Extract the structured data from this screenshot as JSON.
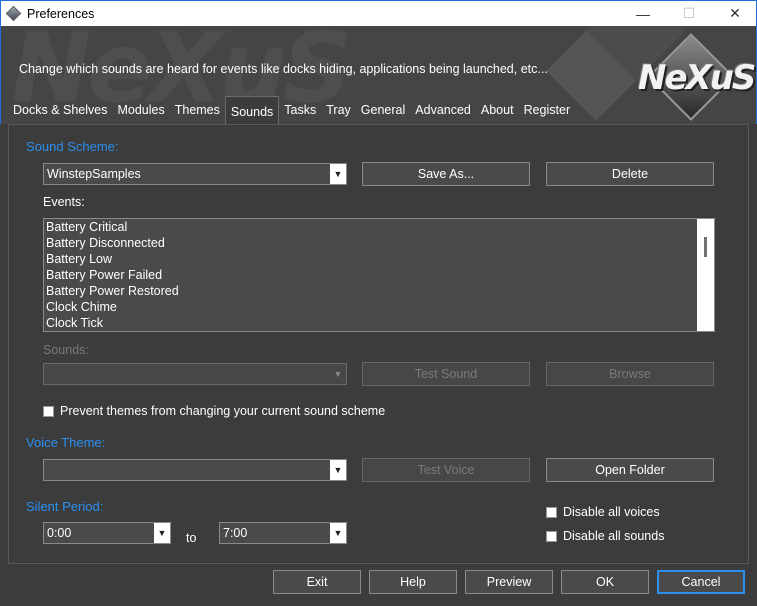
{
  "window": {
    "title": "Preferences",
    "minimize_glyph": "—",
    "maximize_glyph": "☐",
    "close_glyph": "✕"
  },
  "banner": {
    "watermark": "NeXuS",
    "description": "Change which sounds are heard for events like docks hiding, applications being launched, etc...",
    "logo": "NeXuS"
  },
  "tabs": [
    "Docks & Shelves",
    "Modules",
    "Themes",
    "Sounds",
    "Tasks",
    "Tray",
    "General",
    "Advanced",
    "About",
    "Register"
  ],
  "active_tab": "Sounds",
  "sound_scheme": {
    "heading": "Sound Scheme:",
    "selected": "WinstepSamples",
    "save_as": "Save As...",
    "delete": "Delete"
  },
  "events": {
    "label": "Events:",
    "items": [
      "Battery Critical",
      "Battery Disconnected",
      "Battery Low",
      "Battery Power Failed",
      "Battery Power Restored",
      "Clock Chime",
      "Clock Tick"
    ]
  },
  "sounds": {
    "label": "Sounds:",
    "selected": "",
    "test_sound": "Test Sound",
    "browse": "Browse"
  },
  "prevent_themes": "Prevent themes from changing your current sound scheme",
  "voice_theme": {
    "heading": "Voice Theme:",
    "selected": "",
    "test_voice": "Test Voice",
    "open_folder": "Open Folder"
  },
  "silent_period": {
    "heading": "Silent Period:",
    "from": "0:00",
    "to_label": "to",
    "to": "7:00"
  },
  "disable_voices": "Disable all voices",
  "disable_sounds": "Disable all sounds",
  "footer": {
    "exit": "Exit",
    "help": "Help",
    "preview": "Preview",
    "ok": "OK",
    "cancel": "Cancel"
  },
  "colors": {
    "accent": "#2b8ff0",
    "background": "#3c3c3c"
  }
}
